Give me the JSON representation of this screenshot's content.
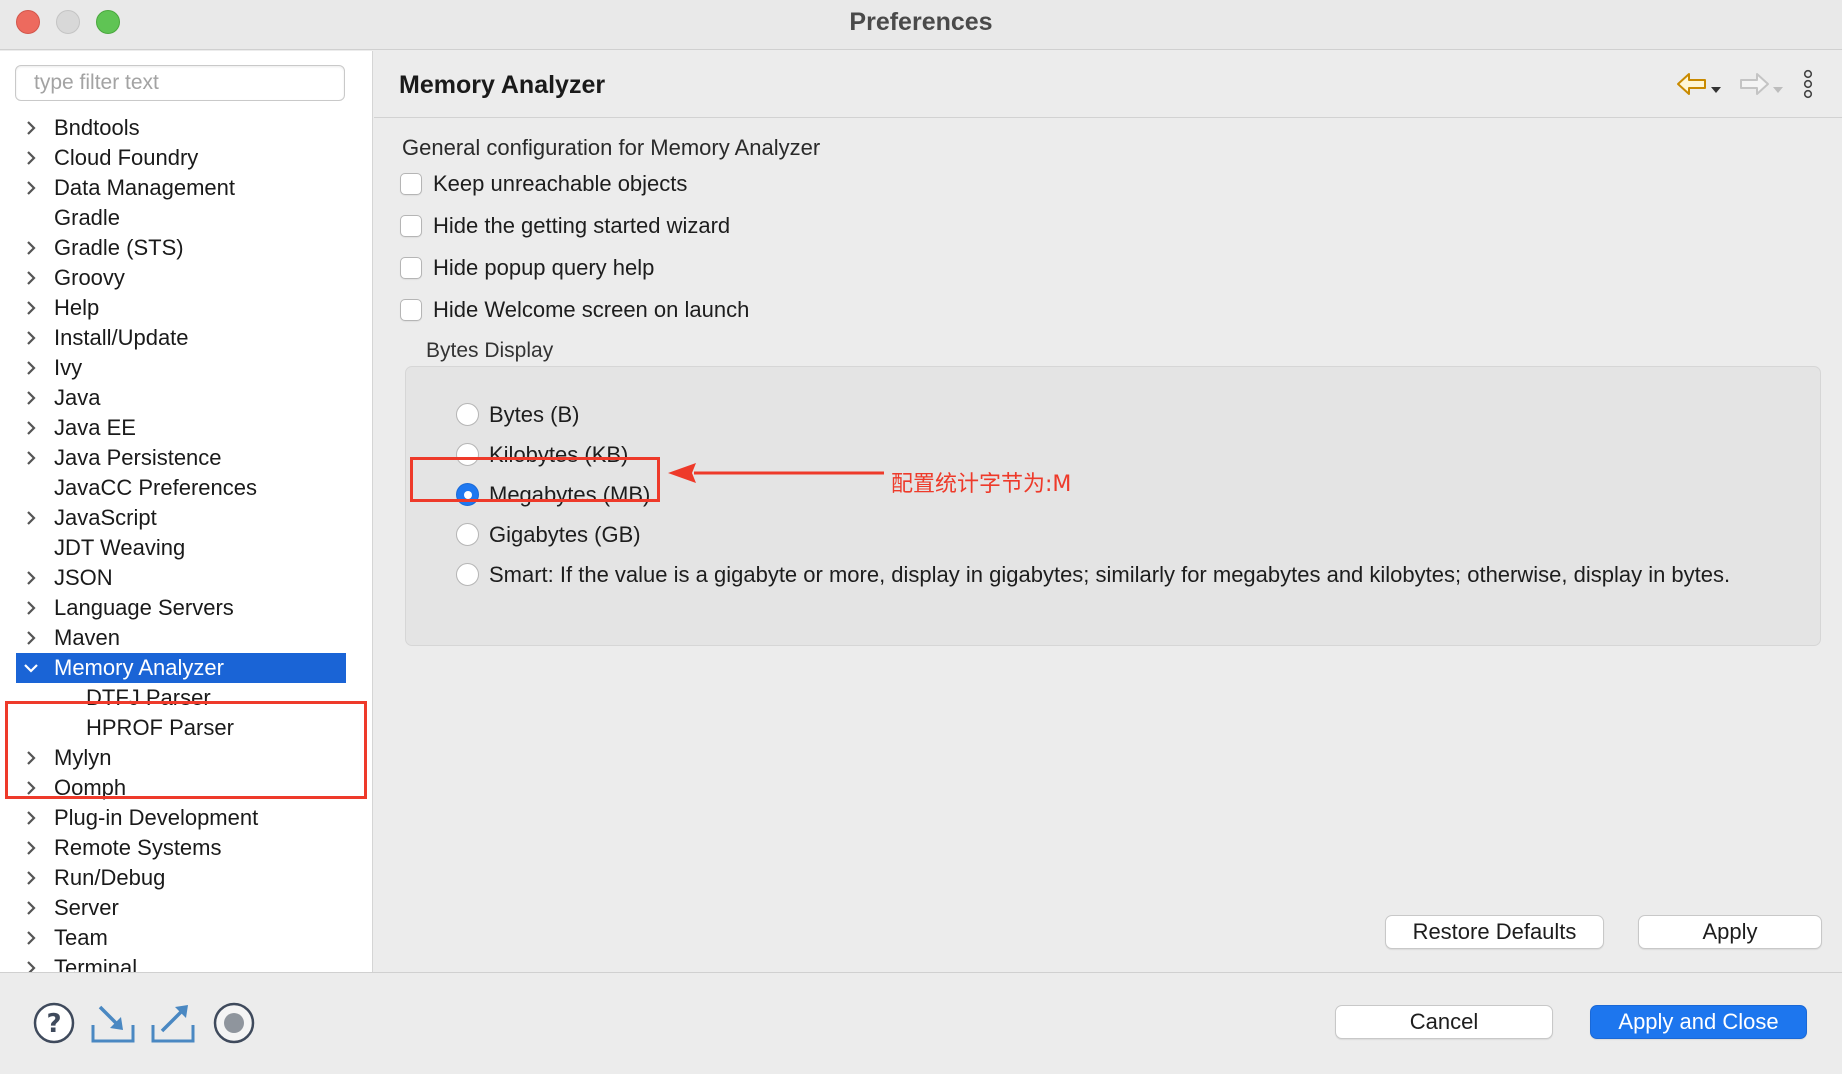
{
  "window": {
    "title": "Preferences"
  },
  "sidebar": {
    "filter_placeholder": "type filter text",
    "items": [
      {
        "label": "Bndtools",
        "expandable": true
      },
      {
        "label": "Cloud Foundry",
        "expandable": true
      },
      {
        "label": "Data Management",
        "expandable": true
      },
      {
        "label": "Gradle",
        "expandable": false
      },
      {
        "label": "Gradle (STS)",
        "expandable": true
      },
      {
        "label": "Groovy",
        "expandable": true
      },
      {
        "label": "Help",
        "expandable": true
      },
      {
        "label": "Install/Update",
        "expandable": true
      },
      {
        "label": "Ivy",
        "expandable": true
      },
      {
        "label": "Java",
        "expandable": true
      },
      {
        "label": "Java EE",
        "expandable": true
      },
      {
        "label": "Java Persistence",
        "expandable": true
      },
      {
        "label": "JavaCC Preferences",
        "expandable": false
      },
      {
        "label": "JavaScript",
        "expandable": true
      },
      {
        "label": "JDT Weaving",
        "expandable": false
      },
      {
        "label": "JSON",
        "expandable": true
      },
      {
        "label": "Language Servers",
        "expandable": true
      },
      {
        "label": "Maven",
        "expandable": true
      },
      {
        "label": "Memory Analyzer",
        "expandable": true,
        "expanded": true,
        "selected": true
      },
      {
        "label": "DTFJ Parser",
        "child": true
      },
      {
        "label": "HPROF Parser",
        "child": true
      },
      {
        "label": "Mylyn",
        "expandable": true
      },
      {
        "label": "Oomph",
        "expandable": true
      },
      {
        "label": "Plug-in Development",
        "expandable": true
      },
      {
        "label": "Remote Systems",
        "expandable": true
      },
      {
        "label": "Run/Debug",
        "expandable": true
      },
      {
        "label": "Server",
        "expandable": true
      },
      {
        "label": "Team",
        "expandable": true
      },
      {
        "label": "Terminal",
        "expandable": true
      }
    ]
  },
  "page": {
    "title": "Memory Analyzer",
    "description": "General configuration for Memory Analyzer",
    "checkboxes": [
      {
        "label": "Keep unreachable objects",
        "checked": false
      },
      {
        "label": "Hide the getting started wizard",
        "checked": false
      },
      {
        "label": "Hide popup query help",
        "checked": false
      },
      {
        "label": "Hide Welcome screen on launch",
        "checked": false
      }
    ],
    "bytes_display": {
      "label": "Bytes Display",
      "options": [
        {
          "label": "Bytes (B)",
          "selected": false
        },
        {
          "label": "Kilobytes (KB)",
          "selected": false
        },
        {
          "label": "Megabytes (MB)",
          "selected": true
        },
        {
          "label": "Gigabytes (GB)",
          "selected": false
        },
        {
          "label": "Smart: If the value is a gigabyte or more, display in gigabytes; similarly for megabytes and kilobytes; otherwise, display in bytes.",
          "selected": false
        }
      ]
    },
    "annotation": "配置统计字节为:M",
    "restore_defaults_label": "Restore Defaults",
    "apply_label": "Apply"
  },
  "footer": {
    "cancel_label": "Cancel",
    "apply_close_label": "Apply and Close"
  },
  "colors": {
    "accent": "#1d76ee",
    "selection": "#1a64d6",
    "annotation": "#ee3a2a"
  },
  "icons": [
    "help-icon",
    "import-icon",
    "export-icon",
    "record-icon",
    "back-arrow-icon",
    "forward-arrow-icon",
    "view-menu-icon",
    "chevron-right-icon",
    "chevron-down-icon"
  ]
}
